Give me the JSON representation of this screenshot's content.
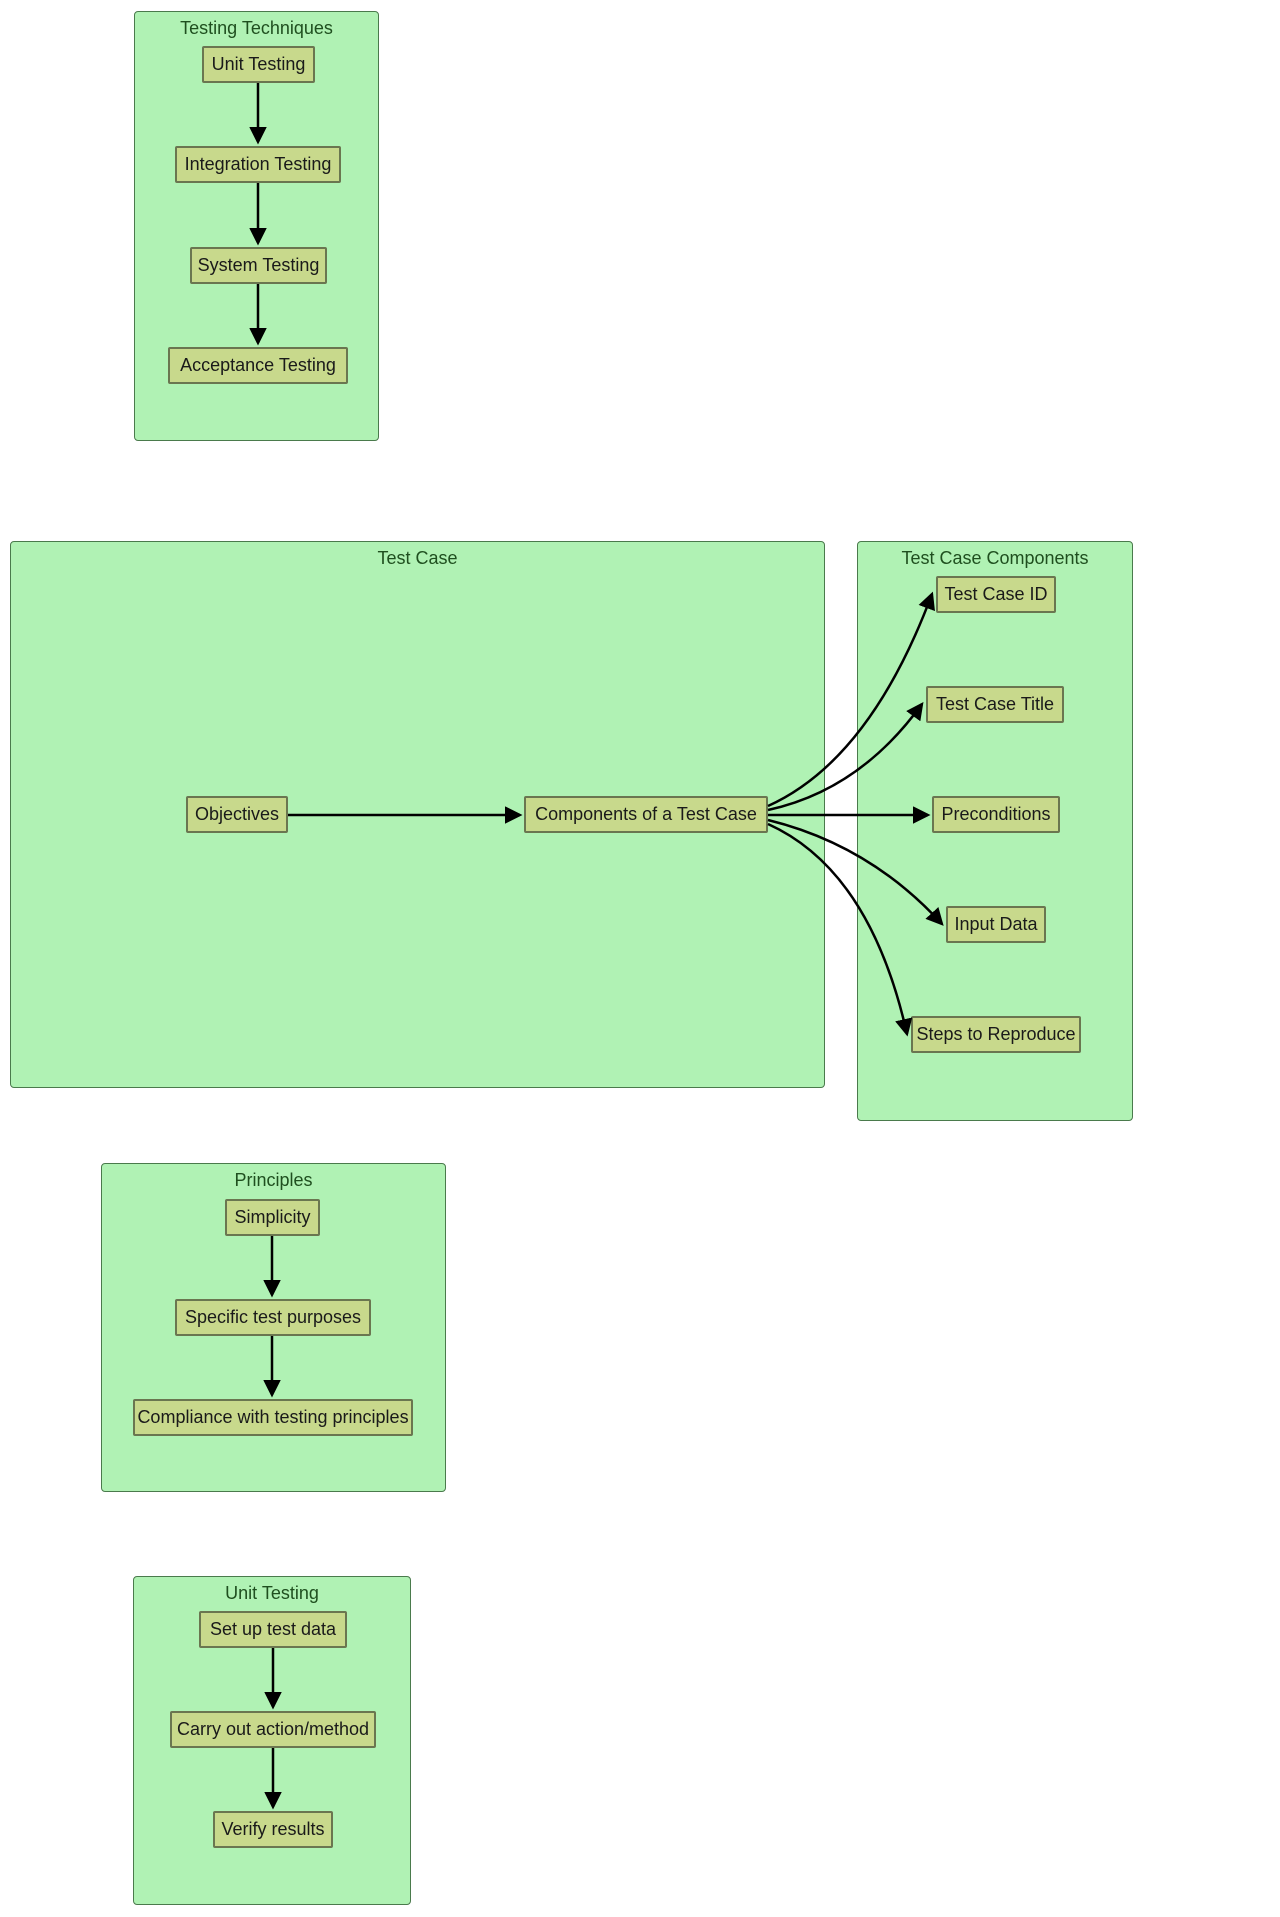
{
  "clusters": {
    "testingTechniques": {
      "title": "Testing Techniques",
      "nodes": {
        "unit": "Unit Testing",
        "integration": "Integration Testing",
        "system": "System Testing",
        "acceptance": "Acceptance Testing"
      }
    },
    "testCase": {
      "title": "Test Case",
      "nodes": {
        "objectives": "Objectives",
        "components": "Components of a Test Case"
      }
    },
    "testCaseComponents": {
      "title": "Test Case Components",
      "nodes": {
        "id": "Test Case ID",
        "titleNode": "Test Case Title",
        "preconditions": "Preconditions",
        "inputData": "Input Data",
        "steps": "Steps to Reproduce"
      }
    },
    "principles": {
      "title": "Principles",
      "nodes": {
        "simplicity": "Simplicity",
        "specific": "Specific test purposes",
        "compliance": "Compliance with testing principles"
      }
    },
    "unitTesting": {
      "title": "Unit Testing",
      "nodes": {
        "setup": "Set up test data",
        "carry": "Carry out action/method",
        "verify": "Verify results"
      }
    }
  }
}
